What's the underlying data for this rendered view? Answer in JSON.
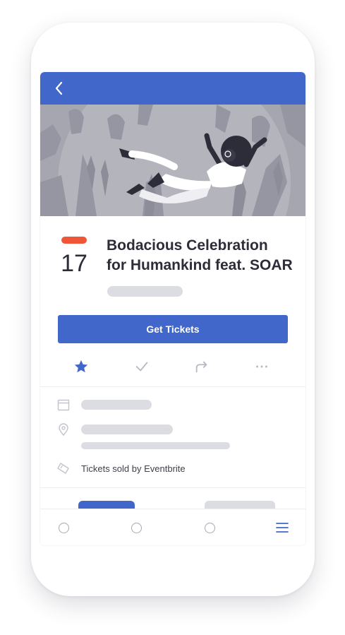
{
  "event": {
    "day": "17",
    "title_line1": "Bodacious Celebration",
    "title_line2": "for Humankind feat. SOAR"
  },
  "cta": {
    "get_tickets_label": "Get Tickets"
  },
  "info": {
    "sold_by": "Tickets sold by Eventbrite"
  },
  "actions": [
    "star-icon",
    "checkmark-icon",
    "share-icon",
    "more-icon"
  ],
  "tabs": [
    "home-tab",
    "search-tab",
    "tickets-tab",
    "menu-tab"
  ],
  "colors": {
    "brand": "#4267cb",
    "accent": "#f05537",
    "text": "#2d2d3a",
    "skeleton": "#dcdce3"
  }
}
